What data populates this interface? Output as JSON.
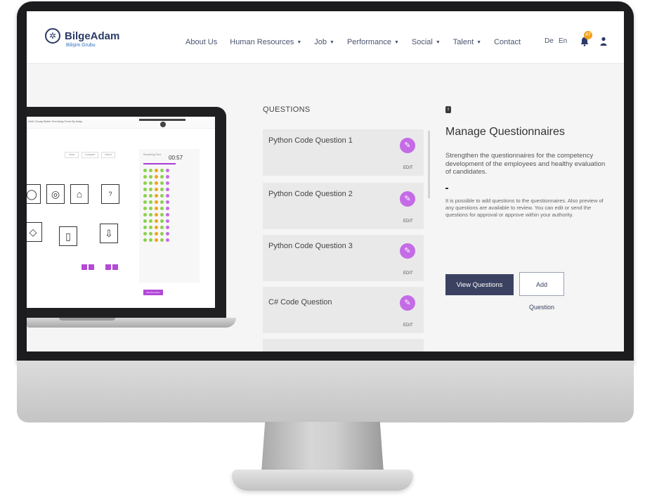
{
  "brand": {
    "name": "BilgeAdam",
    "subtitle": "Bilişim Grubu"
  },
  "nav": {
    "items": [
      {
        "label": "About Us",
        "dropdown": false
      },
      {
        "label": "Human Resources",
        "dropdown": true
      },
      {
        "label": "Job",
        "dropdown": true
      },
      {
        "label": "Performance",
        "dropdown": true
      },
      {
        "label": "Social",
        "dropdown": true
      },
      {
        "label": "Talent",
        "dropdown": true
      },
      {
        "label": "Contact",
        "dropdown": false
      }
    ],
    "lang_de": "De",
    "lang_en": "En",
    "notification_count": "47",
    "icons": [
      "bell-icon",
      "user-icon"
    ]
  },
  "laptop": {
    "window_title": "Ünlü Cevap Bekle Yeni Aday Form By Aday",
    "timer": "00:57",
    "timer_label": "Remaining Time",
    "buttons": [
      "Clear",
      "Compare",
      "Select"
    ],
    "shape_symbol": "?",
    "finish_label": "End the Exam"
  },
  "questions": {
    "heading": "QUESTIONS",
    "edit_label": "EDIT",
    "items": [
      {
        "title": "Python Code Question 1"
      },
      {
        "title": "Python Code Question 2"
      },
      {
        "title": "Python Code Question 3"
      },
      {
        "title": "C# Code Question"
      }
    ]
  },
  "manage": {
    "title": "Manage Questionnaires",
    "lead": "Strengthen the questionnaires for the competency development of the employees and healthy evaluation of candidates.",
    "description": "It is possible to add questions to the questionnaires. Also preview of any questions are available to review. You can edit or send the questions for approval or approve within your authority.",
    "view_button": "View Questions",
    "add_button": "Add Question"
  },
  "colors": {
    "accent_purple": "#c46be6",
    "primary_navy": "#3b4261",
    "badge_orange": "#f2a21b"
  }
}
